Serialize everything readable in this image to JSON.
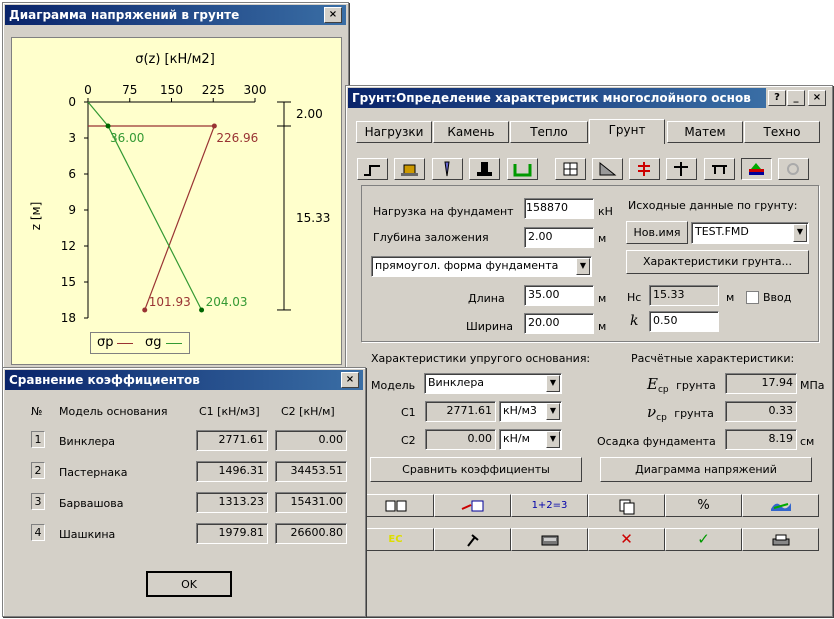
{
  "diagram_window": {
    "title": "Диаграмма напряжений в грунте",
    "close": "×",
    "chart_title": "σ(z) [кН/м2]",
    "x_ticks": [
      "0",
      "75",
      "150",
      "225",
      "300"
    ],
    "y_ticks": [
      "0",
      "3",
      "6",
      "9",
      "12",
      "15",
      "18"
    ],
    "y_label": "z [м]",
    "dim_top": "2.00",
    "dim_bottom": "15.33",
    "labels": {
      "sp_top": "226.96",
      "sg_top": "36.00",
      "sp_bottom": "101.93",
      "sg_bottom": "204.03"
    },
    "legend": {
      "sp": "σp",
      "sg": "σg"
    }
  },
  "chart_data": {
    "type": "line",
    "title": "σ(z) [кН/м2]",
    "ylabel": "z [м]",
    "xlim": [
      0,
      300
    ],
    "ylim": [
      0,
      18
    ],
    "series": [
      {
        "name": "σp",
        "color": "#993333",
        "points": [
          [
            226.96,
            2.0
          ],
          [
            101.93,
            17.33
          ]
        ]
      },
      {
        "name": "σg",
        "color": "#339933",
        "points": [
          [
            0,
            0
          ],
          [
            36.0,
            2.0
          ],
          [
            204.03,
            17.33
          ]
        ]
      }
    ],
    "annotations": [
      "2.00",
      "15.33",
      "226.96",
      "36.00",
      "101.93",
      "204.03"
    ]
  },
  "main_window": {
    "title": "Грунт:Определение характеристик многослойного основ",
    "title_buttons": [
      "?",
      "_",
      "×"
    ],
    "tabs": [
      "Нагрузки",
      "Камень",
      "Тепло",
      "Грунт",
      "Матем",
      "Техно"
    ],
    "active_tab": "Грунт",
    "load_label": "Нагрузка на фундамент",
    "load_value": "158870",
    "load_unit": "кН",
    "depth_label": "Глубина заложения",
    "depth_value": "2.00",
    "depth_unit": "м",
    "shape_value": "прямоугол. форма фундамента",
    "length_label": "Длина",
    "length_value": "35.00",
    "length_unit": "м",
    "width_label": "Ширина",
    "width_value": "20.00",
    "width_unit": "м",
    "soil_input_label": "Исходные данные по грунту:",
    "new_name_button": "Нов.имя",
    "file_value": "TEST.FMD",
    "soil_char_button": "Характеристики грунта...",
    "hc_label": "Нс",
    "hc_value": "15.33",
    "hc_unit": "м",
    "input_label": "Ввод",
    "k_label": "k",
    "k_value": "0.50",
    "elastic_title": "Характеристики упругого основания:",
    "model_label": "Модель",
    "model_value": "Винклера",
    "c1_label": "C1",
    "c1_value": "2771.61",
    "c1_unit": "кН/м3",
    "c2_label": "C2",
    "c2_value": "0.00",
    "c2_unit": "кН/м",
    "calc_title": "Расчётные характеристики:",
    "ecp_label": "E",
    "ecp_sub": "ср",
    "ecp_word": "грунта",
    "ecp_value": "17.94",
    "ecp_unit": "МПа",
    "vcp_label": "ν",
    "vcp_sub": "ср",
    "vcp_word": "грунта",
    "vcp_value": "0.33",
    "settle_label": "Осадка фундамента",
    "settle_value": "8.19",
    "settle_unit": "см",
    "compare_button": "Сравнить коэффициенты",
    "diagram_button": "Диаграмма напряжений",
    "toolbar_text": {
      "sum": "1+2=3",
      "percent": "%"
    }
  },
  "compare_window": {
    "title": "Сравнение коэффициентов",
    "close": "×",
    "headers": [
      "№",
      "Модель основания",
      "C1 [кН/м3]",
      "C2 [кН/м]"
    ],
    "rows": [
      {
        "n": "1",
        "model": "Винклера",
        "c1": "2771.61",
        "c2": "0.00"
      },
      {
        "n": "2",
        "model": "Пастернака",
        "c1": "1496.31",
        "c2": "34453.51"
      },
      {
        "n": "3",
        "model": "Барвашова",
        "c1": "1313.23",
        "c2": "15431.00"
      },
      {
        "n": "4",
        "model": "Шашкина",
        "c1": "1979.81",
        "c2": "26600.80"
      }
    ],
    "ok_button": "OK"
  },
  "colors": {
    "plot_bg": "#ffffcc",
    "sp": "#993333",
    "sg": "#339933",
    "title_start": "#0a246a",
    "title_end": "#3a6ea5"
  }
}
